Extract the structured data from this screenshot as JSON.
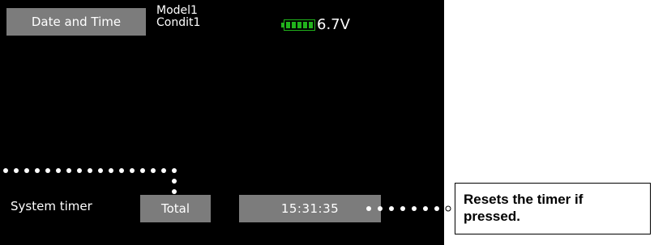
{
  "screen": {
    "title": "Date and Time",
    "model_name": "Model1",
    "condition_name": "Condit1",
    "battery": {
      "icon": "battery-icon",
      "level": 1.0,
      "color": "#21b31c",
      "voltage": "6.7V"
    }
  },
  "system_timer": {
    "label": "System timer",
    "mode_button": "Total",
    "time_value": "15:31:35"
  },
  "callout": {
    "text": "Resets the timer if pressed."
  },
  "colors": {
    "screen_background": "#000000",
    "button_background": "#7c7c7c",
    "leader_dots": "#ffffff"
  }
}
